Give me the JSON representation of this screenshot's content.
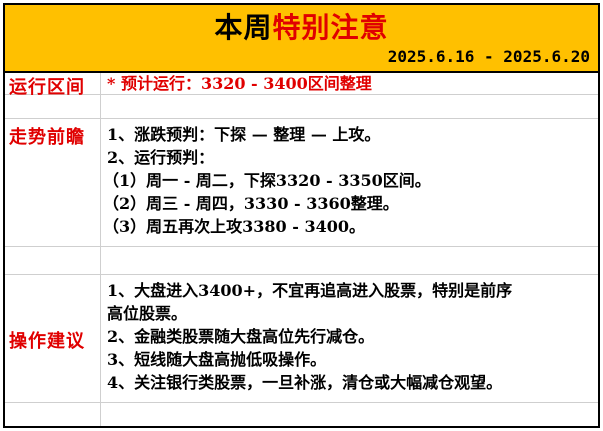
{
  "title": {
    "normal": "本周",
    "highlight": "特别注意"
  },
  "date_range": "2025.6.16 - 2025.6.20",
  "sections": {
    "range": {
      "label": "运行区间",
      "text": "* 预计运行：3320 - 3400区间整理"
    },
    "outlook": {
      "label": "走势前瞻",
      "lines": [
        "1、涨跌预判：下探 — 整理 — 上攻。",
        "2、运行预判：",
        "（1）周一 - 周二，下探3320 - 3350区间。",
        "（2）周三 - 周四，3330 - 3360整理。",
        "（3）周五再次上攻3380 - 3400。"
      ]
    },
    "advice": {
      "label": "操作建议",
      "lines": [
        "1、大盘进入3400+，不宜再追高进入股票，特别是前序",
        "高位股票。",
        "2、金融类股票随大盘高位先行减仓。",
        "3、短线随大盘高抛低吸操作。",
        "4、关注银行类股票，一旦补涨，清仓或大幅减仓观望。"
      ]
    }
  },
  "colors": {
    "header_bg": "#ffc000",
    "accent": "#e00000"
  }
}
